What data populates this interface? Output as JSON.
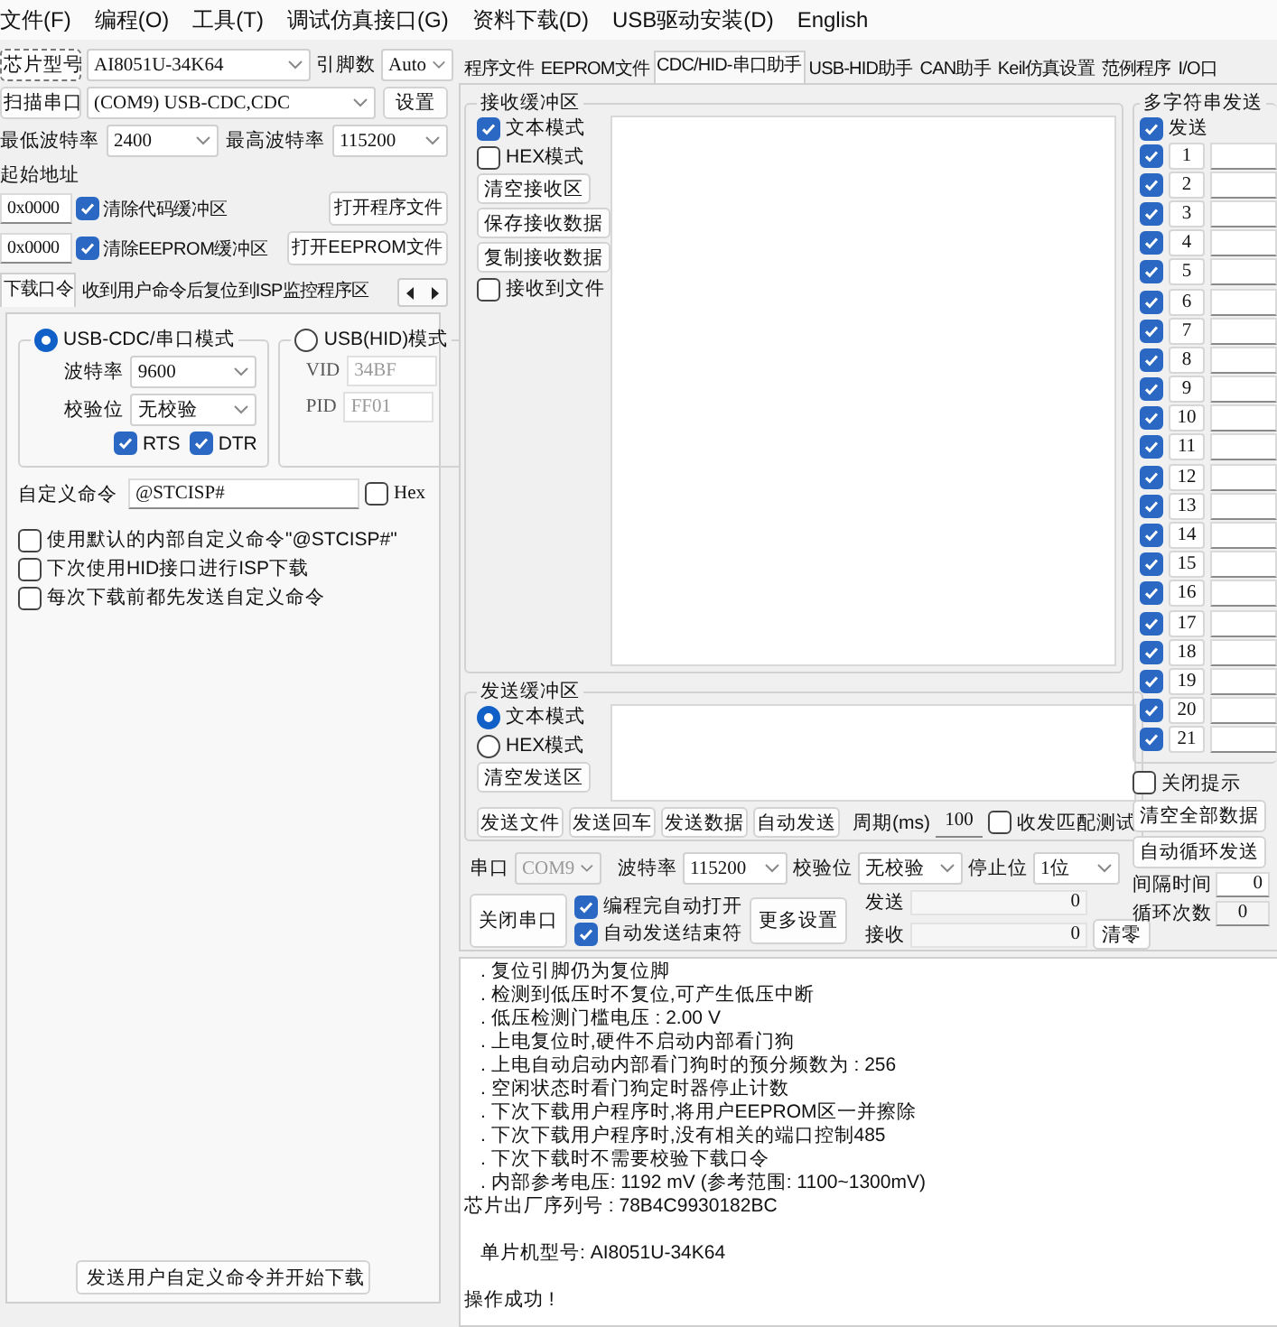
{
  "menu": [
    "文件(F)",
    "编程(O)",
    "工具(T)",
    "调试仿真接口(G)",
    "资料下载(D)",
    "USB驱动安装(D)",
    "English"
  ],
  "chip": {
    "button": "芯片型号",
    "value": "AI8051U-34K64",
    "pins_label": "引脚数",
    "pins_value": "Auto"
  },
  "port": {
    "button": "扫描串口",
    "value": "(COM9) USB-CDC,CDC",
    "settings_button": "设置"
  },
  "baud": {
    "min_label": "最低波特率",
    "min_value": "2400",
    "max_label": "最高波特率",
    "max_value": "115200"
  },
  "start_address": {
    "label": "起始地址",
    "rows": [
      {
        "address": "0x0000",
        "option": "清除代码缓冲区",
        "checked": true,
        "button": "打开程序文件"
      },
      {
        "address": "0x0000",
        "option": "清除EEPROM缓冲区",
        "checked": true,
        "button": "打开EEPROM文件"
      }
    ]
  },
  "left_tabs": [
    {
      "label": "下载口令",
      "selected": true
    },
    {
      "label": "收到用户命令后复位到ISP监控程序区",
      "selected": false
    }
  ],
  "download": {
    "modes": [
      {
        "label": "USB-CDC/串口模式",
        "selected": true,
        "fields": [
          {
            "kind": "dropdown",
            "label": "波特率",
            "value": "9600"
          },
          {
            "kind": "dropdown",
            "label": "校验位",
            "value": "无校验"
          }
        ],
        "checks": [
          {
            "label": "RTS",
            "checked": true
          },
          {
            "label": "DTR",
            "checked": true
          }
        ]
      },
      {
        "label": "USB(HID)模式",
        "selected": false,
        "fields": [
          {
            "kind": "field",
            "label": "VID",
            "value": "34BF"
          },
          {
            "kind": "field",
            "label": "PID",
            "value": "FF01"
          }
        ]
      }
    ],
    "command_label": "自定义命令",
    "command_value": "@STCISP#",
    "hex": {
      "label": "Hex",
      "checked": false
    },
    "options": [
      {
        "label": "使用默认的内部自定义命令\"@STCISP#\"",
        "checked": false
      },
      {
        "label": "下次使用HID接口进行ISP下载",
        "checked": false
      },
      {
        "label": "每次下载前都先发送自定义命令",
        "checked": false
      }
    ],
    "start_button": "发送用户自定义命令并开始下载"
  },
  "tabs": [
    {
      "label": "程序文件",
      "selected": false
    },
    {
      "label": "EEPROM文件",
      "selected": false
    },
    {
      "label": "CDC/HID-串口助手",
      "selected": true
    },
    {
      "label": "USB-HID助手",
      "selected": false
    },
    {
      "label": "CAN助手",
      "selected": false
    },
    {
      "label": "Keil仿真设置",
      "selected": false
    },
    {
      "label": "范例程序",
      "selected": false
    },
    {
      "label": "I/O口",
      "selected": false
    }
  ],
  "receive": {
    "title": "接收缓冲区",
    "modes": [
      {
        "label": "文本模式",
        "checked": true
      },
      {
        "label": "HEX模式",
        "checked": false
      }
    ],
    "buttons": [
      "清空接收区",
      "保存接收数据",
      "复制接收数据"
    ],
    "to_file": {
      "label": "接收到文件",
      "checked": false
    }
  },
  "send": {
    "title": "发送缓冲区",
    "modes": [
      {
        "label": "文本模式",
        "selected": true
      },
      {
        "label": "HEX模式",
        "selected": false
      }
    ],
    "clear_button": "清空发送区",
    "actions": [
      "发送文件",
      "发送回车",
      "发送数据",
      "自动发送"
    ],
    "period_label": "周期(ms)",
    "period_value": "100",
    "match_test": {
      "label": "收发匹配测试",
      "checked": false
    }
  },
  "serial": {
    "port_label": "串口",
    "port_value": "COM9",
    "port_disabled": true,
    "baud_label": "波特率",
    "baud_value": "115200",
    "parity_label": "校验位",
    "parity_value": "无校验",
    "stop_label": "停止位",
    "stop_value": "1位",
    "close_button": "关闭串口",
    "options": [
      {
        "label": "编程完自动打开",
        "checked": true
      },
      {
        "label": "自动发送结束符",
        "checked": true
      }
    ],
    "more_button": "更多设置",
    "counters": [
      {
        "label": "发送",
        "value": "0"
      },
      {
        "label": "接收",
        "value": "0"
      }
    ],
    "clear_button": "清零"
  },
  "multi": {
    "title": "多字符串发送",
    "send": {
      "label": "发送",
      "checked": true
    },
    "items": [
      {
        "number": "1",
        "checked": true
      },
      {
        "number": "2",
        "checked": true
      },
      {
        "number": "3",
        "checked": true
      },
      {
        "number": "4",
        "checked": true
      },
      {
        "number": "5",
        "checked": true
      },
      {
        "number": "6",
        "checked": true
      },
      {
        "number": "7",
        "checked": true
      },
      {
        "number": "8",
        "checked": true
      },
      {
        "number": "9",
        "checked": true
      },
      {
        "number": "10",
        "checked": true
      },
      {
        "number": "11",
        "checked": true
      },
      {
        "number": "12",
        "checked": true
      },
      {
        "number": "13",
        "checked": true
      },
      {
        "number": "14",
        "checked": true
      },
      {
        "number": "15",
        "checked": true
      },
      {
        "number": "16",
        "checked": true
      },
      {
        "number": "17",
        "checked": true
      },
      {
        "number": "18",
        "checked": true
      },
      {
        "number": "19",
        "checked": true
      },
      {
        "number": "20",
        "checked": true
      },
      {
        "number": "21",
        "checked": true
      }
    ],
    "close_hint": {
      "label": "关闭提示",
      "checked": false
    },
    "buttons": [
      "清空全部数据",
      "自动循环发送"
    ],
    "interval_label": "间隔时间",
    "interval_value": "0",
    "loop_label": "循环次数",
    "loop_value": "0"
  },
  "log": [
    {
      "kind": "bullet",
      "text": ". 复位引脚仍为复位脚"
    },
    {
      "kind": "bullet",
      "text": ". 检测到低压时不复位,可产生低压中断"
    },
    {
      "kind": "bullet",
      "text": ". 低压检测门槛电压 : 2.00 V"
    },
    {
      "kind": "bullet",
      "text": ". 上电复位时,硬件不启动内部看门狗"
    },
    {
      "kind": "bullet",
      "text": ". 上电自动启动内部看门狗时的预分频数为 : 256"
    },
    {
      "kind": "bullet",
      "text": ". 空闲状态时看门狗定时器停止计数"
    },
    {
      "kind": "bullet",
      "text": ". 下次下载用户程序时,将用户EEPROM区一并擦除"
    },
    {
      "kind": "bullet",
      "text": ". 下次下载用户程序时,没有相关的端口控制485"
    },
    {
      "kind": "bullet",
      "text": ". 下次下载时不需要校验下载口令"
    },
    {
      "kind": "bullet",
      "text": ". 内部参考电压: 1192 mV (参考范围: 1100~1300mV)"
    },
    {
      "kind": "plain",
      "text": "芯片出厂序列号 : 78B4C9930182BC"
    },
    {
      "kind": "detail",
      "text": "单片机型号: AI8051U-34K64"
    },
    {
      "kind": "status",
      "text": "操作成功 !"
    }
  ]
}
